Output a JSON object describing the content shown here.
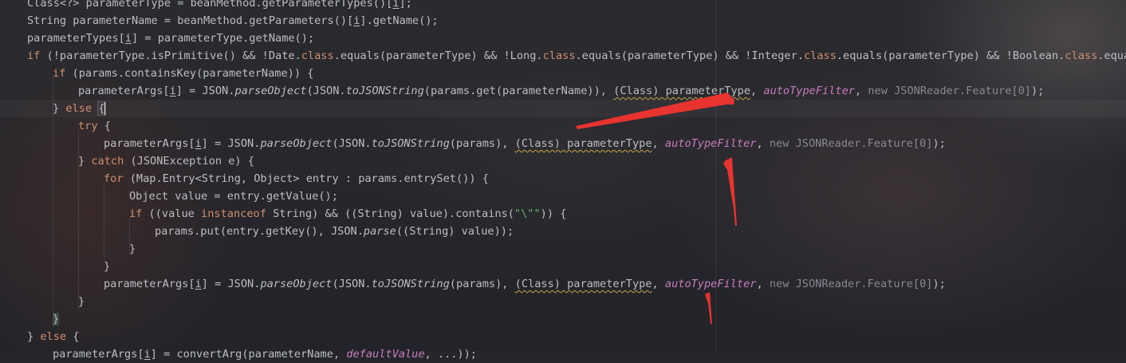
{
  "editor": {
    "lines": [
      {
        "segments": [
          {
            "t": "Class<?> parameterType = beanMethod.getParameterTypes()["
          },
          {
            "t": "i",
            "cls": "uline"
          },
          {
            "t": "];"
          }
        ]
      },
      {
        "segments": [
          {
            "t": "String parameterName = beanMethod.getParameters()["
          },
          {
            "t": "i",
            "cls": "uline"
          },
          {
            "t": "].getName();"
          }
        ]
      },
      {
        "segments": [
          {
            "t": "parameterTypes["
          },
          {
            "t": "i",
            "cls": "uline"
          },
          {
            "t": "] = parameterType.getName();"
          }
        ]
      },
      {
        "segments": [
          {
            "t": "if",
            "cls": "kw"
          },
          {
            "t": " (!parameterType.isPrimitive() && !Date."
          },
          {
            "t": "class",
            "cls": "kw"
          },
          {
            "t": ".equals(parameterType) && !Long."
          },
          {
            "t": "class",
            "cls": "kw"
          },
          {
            "t": ".equals(parameterType) && !Integer."
          },
          {
            "t": "class",
            "cls": "kw"
          },
          {
            "t": ".equals(parameterType) && !Boolean."
          },
          {
            "t": "class",
            "cls": "kw"
          },
          {
            "t": ".equals(p"
          }
        ]
      },
      {
        "segments": [
          {
            "t": "if",
            "cls": "kw"
          },
          {
            "t": " (params.containsKey(parameterName)) {"
          }
        ]
      },
      {
        "segments": [
          {
            "t": "parameterArgs["
          },
          {
            "t": "i",
            "cls": "uline"
          },
          {
            "t": "] = JSON."
          },
          {
            "t": "parseObject",
            "cls": "it"
          },
          {
            "t": "(JSON."
          },
          {
            "t": "toJSONString",
            "cls": "it"
          },
          {
            "t": "(params.get(parameterName)), "
          },
          {
            "t": "(Class) parameterType",
            "cls": "wavy"
          },
          {
            "t": ", "
          },
          {
            "t": "autoTypeFilter",
            "cls": "fld"
          },
          {
            "t": ", "
          },
          {
            "t": "new JSONReader.Feature[0]",
            "cls": "grey"
          },
          {
            "t": ");"
          }
        ]
      },
      {
        "segments": [
          {
            "t": "} "
          },
          {
            "t": "else",
            "cls": "kw"
          },
          {
            "t": " "
          },
          {
            "t": "{",
            "cls": "brace-hl"
          },
          {
            "t": "",
            "cls": "caret"
          }
        ]
      },
      {
        "segments": [
          {
            "t": "try",
            "cls": "kw"
          },
          {
            "t": " {"
          }
        ]
      },
      {
        "segments": [
          {
            "t": "parameterArgs["
          },
          {
            "t": "i",
            "cls": "uline"
          },
          {
            "t": "] = JSON."
          },
          {
            "t": "parseObject",
            "cls": "it"
          },
          {
            "t": "(JSON."
          },
          {
            "t": "toJSONString",
            "cls": "it"
          },
          {
            "t": "(params), "
          },
          {
            "t": "(Class) parameterType",
            "cls": "wavy"
          },
          {
            "t": ", "
          },
          {
            "t": "autoTypeFilter",
            "cls": "fld"
          },
          {
            "t": ", "
          },
          {
            "t": "new JSONReader.Feature[0]",
            "cls": "grey"
          },
          {
            "t": ");"
          }
        ]
      },
      {
        "segments": [
          {
            "t": "} "
          },
          {
            "t": "catch",
            "cls": "kw"
          },
          {
            "t": " (JSONException e) {"
          }
        ]
      },
      {
        "segments": [
          {
            "t": "for",
            "cls": "kw"
          },
          {
            "t": " (Map.Entry<String, Object> entry : params.entrySet()) {"
          }
        ]
      },
      {
        "segments": [
          {
            "t": "Object value = entry.getValue();"
          }
        ]
      },
      {
        "segments": [
          {
            "t": "if",
            "cls": "kw"
          },
          {
            "t": " ((value "
          },
          {
            "t": "instanceof",
            "cls": "kw"
          },
          {
            "t": " String) && ((String) value).contains("
          },
          {
            "t": "\"\\\"\"",
            "cls": "str"
          },
          {
            "t": ")) {"
          }
        ]
      },
      {
        "segments": [
          {
            "t": "params.put(entry.getKey(), JSON."
          },
          {
            "t": "parse",
            "cls": "it"
          },
          {
            "t": "((String) value));"
          }
        ]
      },
      {
        "segments": [
          {
            "t": "}"
          }
        ]
      },
      {
        "segments": [
          {
            "t": "}"
          }
        ]
      },
      {
        "segments": [
          {
            "t": "parameterArgs["
          },
          {
            "t": "i",
            "cls": "uline"
          },
          {
            "t": "] = JSON."
          },
          {
            "t": "parseObject",
            "cls": "it"
          },
          {
            "t": "(JSON."
          },
          {
            "t": "toJSONString",
            "cls": "it"
          },
          {
            "t": "(params), "
          },
          {
            "t": "(Class) parameterType",
            "cls": "wavy"
          },
          {
            "t": ", "
          },
          {
            "t": "autoTypeFilter",
            "cls": "fld"
          },
          {
            "t": ", "
          },
          {
            "t": "new JSONReader.Feature[0]",
            "cls": "grey"
          },
          {
            "t": ");"
          }
        ]
      },
      {
        "segments": [
          {
            "t": "}"
          }
        ]
      },
      {
        "segments": [
          {
            "t": "}",
            "cls": "brace-hl2"
          }
        ]
      },
      {
        "segments": [
          {
            "t": "} "
          },
          {
            "t": "else",
            "cls": "kw"
          },
          {
            "t": " {"
          }
        ]
      },
      {
        "segments": [
          {
            "t": "parameterArgs["
          },
          {
            "t": "i",
            "cls": "uline"
          },
          {
            "t": "] = convertArg(parameterName, "
          },
          {
            "t": "defaultValue",
            "cls": "fld"
          },
          {
            "t": ", ...));"
          }
        ]
      }
    ]
  },
  "annotations": {
    "arrow_color": "#e8332f"
  }
}
